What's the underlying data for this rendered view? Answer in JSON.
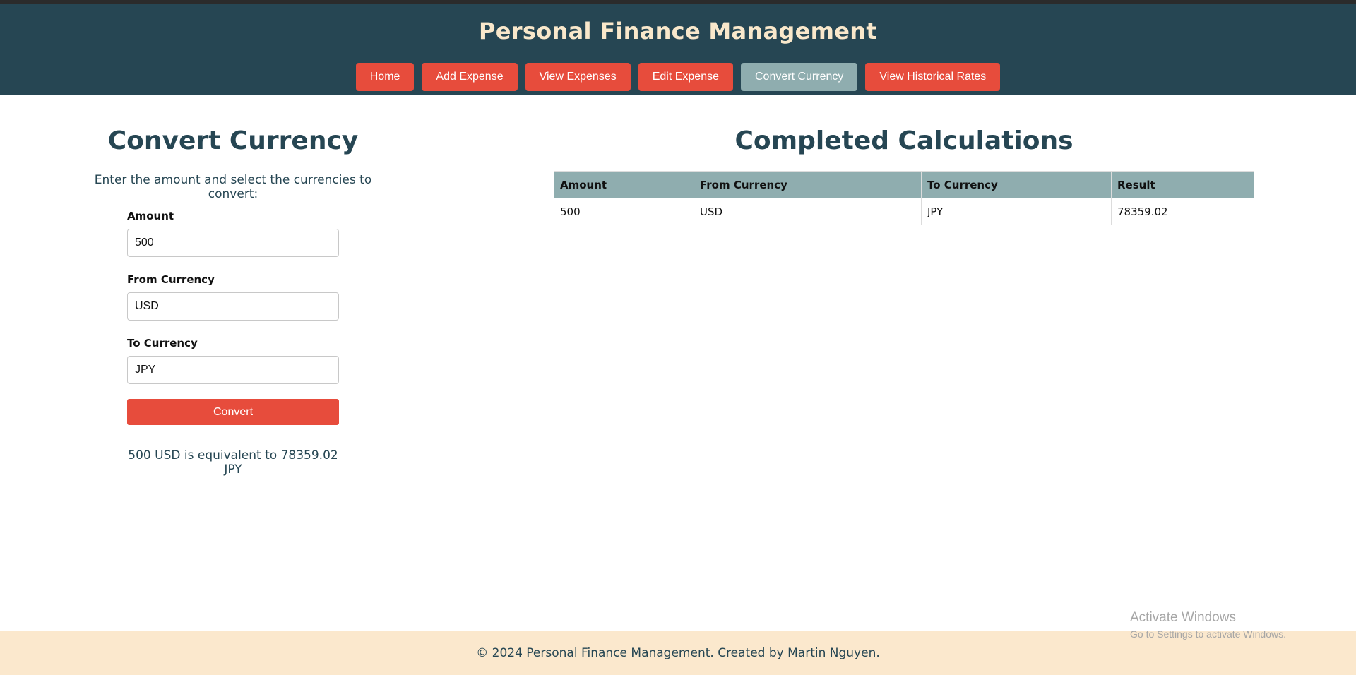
{
  "header": {
    "title": "Personal Finance Management",
    "nav": [
      {
        "label": "Home",
        "active": false
      },
      {
        "label": "Add Expense",
        "active": false
      },
      {
        "label": "View Expenses",
        "active": false
      },
      {
        "label": "Edit Expense",
        "active": false
      },
      {
        "label": "Convert Currency",
        "active": true
      },
      {
        "label": "View Historical Rates",
        "active": false
      }
    ]
  },
  "converter": {
    "title": "Convert Currency",
    "intro": "Enter the amount and select the currencies to convert:",
    "amount_label": "Amount",
    "amount_value": "500",
    "from_label": "From Currency",
    "from_value": "USD",
    "to_label": "To Currency",
    "to_value": "JPY",
    "button_label": "Convert",
    "result": "500 USD is equivalent to 78359.02 JPY"
  },
  "calculations": {
    "title": "Completed Calculations",
    "columns": [
      "Amount",
      "From Currency",
      "To Currency",
      "Result"
    ],
    "rows": [
      [
        "500",
        "USD",
        "JPY",
        "78359.02"
      ]
    ]
  },
  "footer": {
    "text": "© 2024 Personal Finance Management. Created by Martin Nguyen."
  },
  "watermark": {
    "title": "Activate Windows",
    "subtitle": "Go to Settings to activate Windows."
  },
  "colors": {
    "header_bg": "#264653",
    "accent_red": "#e74c3c",
    "active_nav": "#8fadaf",
    "title_cream": "#f9e8cb",
    "footer_bg": "#fbe8cd"
  }
}
